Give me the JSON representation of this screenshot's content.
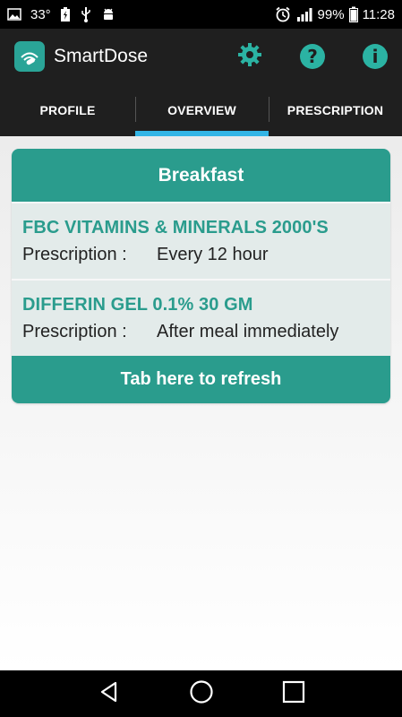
{
  "status_bar": {
    "temperature": "33°",
    "battery_percent": "99%",
    "time": "11:28",
    "left_icons": [
      "image-icon",
      "battery-charging-icon",
      "usb-icon",
      "android-debug-icon"
    ],
    "right_icons": [
      "alarm-icon",
      "signal-icon",
      "battery-icon"
    ]
  },
  "app_bar": {
    "title": "SmartDose",
    "actions": [
      "settings-gear-icon",
      "help-icon",
      "info-icon"
    ],
    "help_glyph": "?",
    "info_glyph": "i"
  },
  "tabs": [
    {
      "label": "PROFILE",
      "active": false
    },
    {
      "label": "OVERVIEW",
      "active": true
    },
    {
      "label": "PRESCRIPTION",
      "active": false
    }
  ],
  "overview": {
    "meal_title": "Breakfast",
    "medications": [
      {
        "name": "FBC VITAMINS & MINERALS 2000'S",
        "prescription_label": "Prescription :",
        "prescription_value": "Every 12 hour"
      },
      {
        "name": "DIFFERIN GEL 0.1% 30 GM",
        "prescription_label": "Prescription :",
        "prescription_value": "After meal immediately"
      }
    ],
    "refresh_label": "Tab here to refresh"
  },
  "colors": {
    "accent_teal": "#2a9c8d",
    "tab_indicator": "#33b5e5",
    "app_bar_bg": "#1f1f1f"
  }
}
